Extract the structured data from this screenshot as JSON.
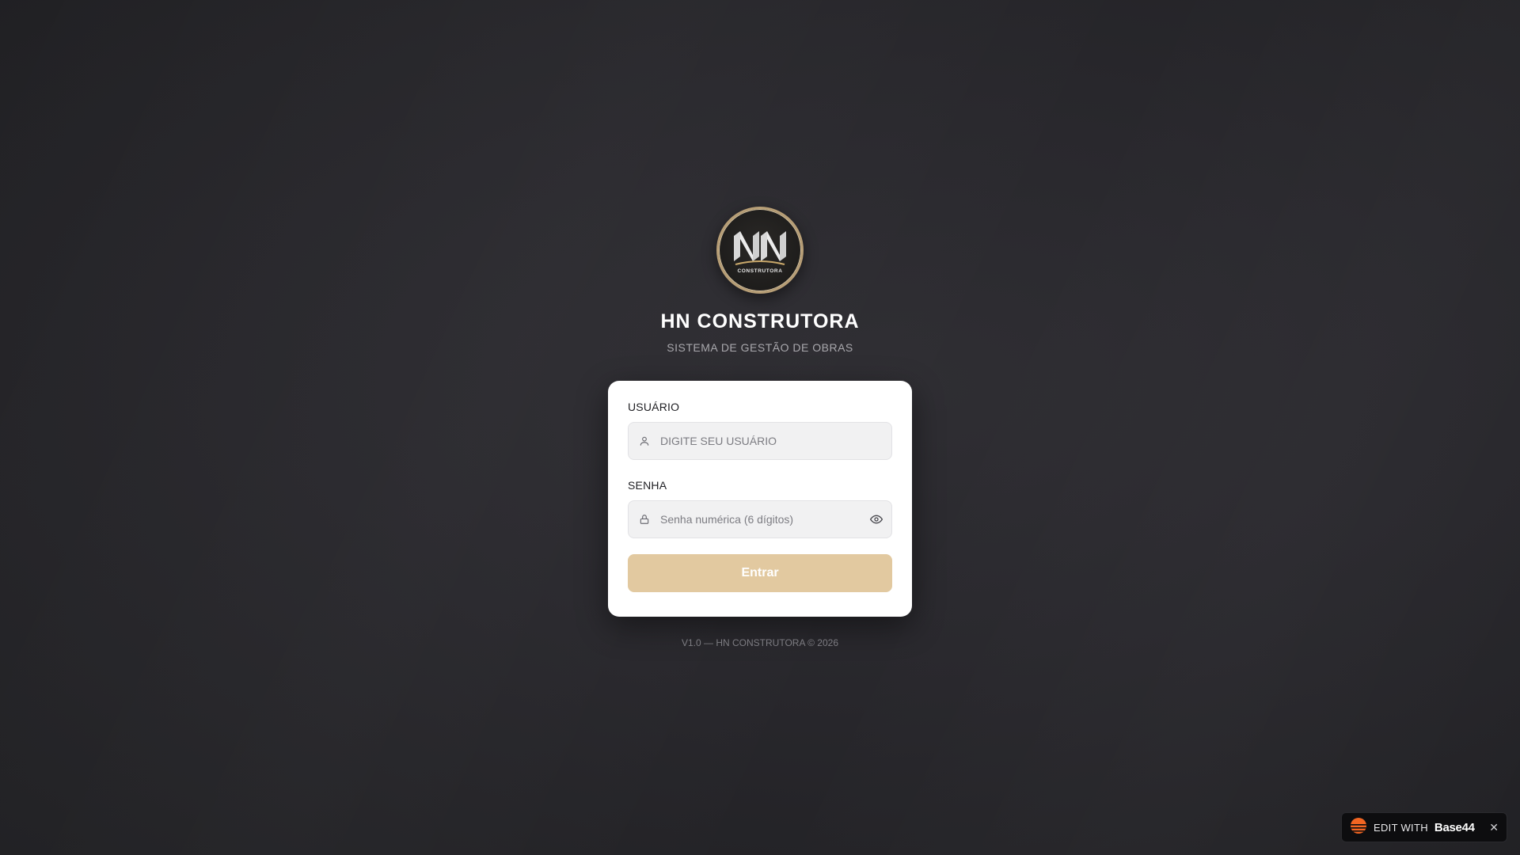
{
  "brand": {
    "title": "HN CONSTRUTORA",
    "subtitle": "SISTEMA DE GESTÃO DE OBRAS",
    "logo_text": "HN",
    "logo_caption": "CONSTRUTORA"
  },
  "form": {
    "user_label": "USUÁRIO",
    "user_placeholder": "DIGITE SEU USUÁRIO",
    "user_value": "",
    "password_label": "SENHA",
    "password_placeholder": "Senha numérica (6 dígitos)",
    "password_value": "",
    "submit_label": "Entrar"
  },
  "footer": {
    "text": "V1.0 — HN CONSTRUTORA © 2026"
  },
  "badge": {
    "edit_label": "EDIT WITH",
    "brand_label": "Base44",
    "close_label": "✕"
  },
  "colors": {
    "accent": "#e2c9a0",
    "logo_ring": "#b79e76",
    "background": "#29282d",
    "badge_icon": "#f26522"
  },
  "icons": {
    "user_field": "user-icon",
    "password_field": "lock-icon",
    "toggle_visibility": "eye-icon",
    "badge_logo": "base44-logo-icon",
    "badge_close": "close-icon"
  }
}
